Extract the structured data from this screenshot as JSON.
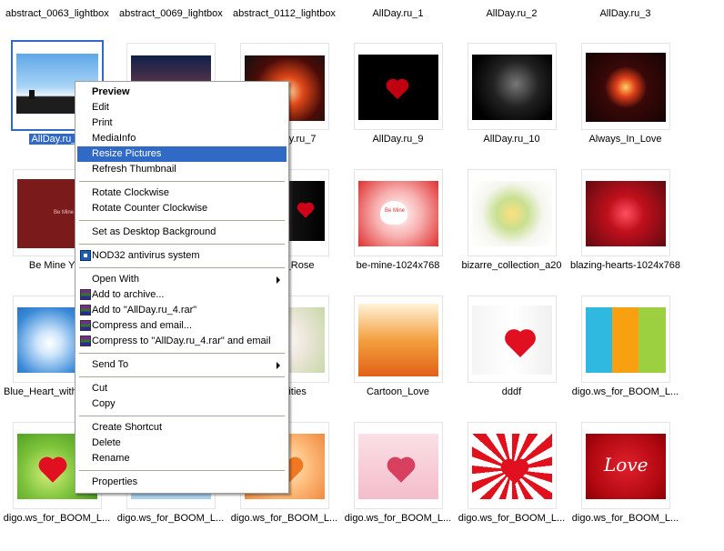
{
  "top_captions": [
    "abstract_0063_lightbox",
    "abstract_0069_lightbox",
    "abstract_0112_lightbox",
    "AllDay.ru_1",
    "AllDay.ru_2",
    "AllDay.ru_3"
  ],
  "rows": [
    [
      "AllDay.ru_4",
      "",
      "AllDay.ru_7",
      "AllDay.ru_9",
      "AllDay.ru_10",
      "Always_In_Love"
    ],
    [
      "Be Mine Yes",
      "",
      "Red_Rose",
      "be-mine-1024x768",
      "bizarre_collection_a20",
      "blazing-hearts-1024x768"
    ],
    [
      "Blue_Heart_with",
      "",
      "amities",
      "Cartoon_Love",
      "dddf",
      "digo.ws_for_BOOM_L..."
    ],
    [
      "digo.ws_for_BOOM_L...",
      "digo.ws_for_BOOM_L...",
      "digo.ws_for_BOOM_L...",
      "digo.ws_for_BOOM_L...",
      "digo.ws_for_BOOM_L...",
      "digo.ws_for_BOOM_L..."
    ]
  ],
  "thumb_labels": {
    "be_mine": "Be Mine",
    "be_mine_small": "Be Mine",
    "love_script": "Love"
  },
  "context_menu": {
    "items": {
      "preview": "Preview",
      "edit": "Edit",
      "print": "Print",
      "mediainfo": "MediaInfo",
      "resize": "Resize Pictures",
      "refresh": "Refresh Thumbnail",
      "rotate_cw": "Rotate Clockwise",
      "rotate_ccw": "Rotate Counter Clockwise",
      "desktop_bg": "Set as Desktop Background",
      "nod32": "NOD32 antivirus system",
      "open_with": "Open With",
      "add_archive": "Add to archive...",
      "add_rar": "Add to \"AllDay.ru_4.rar\"",
      "compress_email": "Compress and email...",
      "compress_rar_email": "Compress to \"AllDay.ru_4.rar\" and email",
      "send_to": "Send To",
      "cut": "Cut",
      "copy": "Copy",
      "create_shortcut": "Create Shortcut",
      "delete": "Delete",
      "rename": "Rename",
      "properties": "Properties"
    },
    "highlighted": "resize"
  },
  "colors": {
    "selection": "#316ac5",
    "menu_border": "#9d9d9d",
    "separator": "#aca899"
  }
}
